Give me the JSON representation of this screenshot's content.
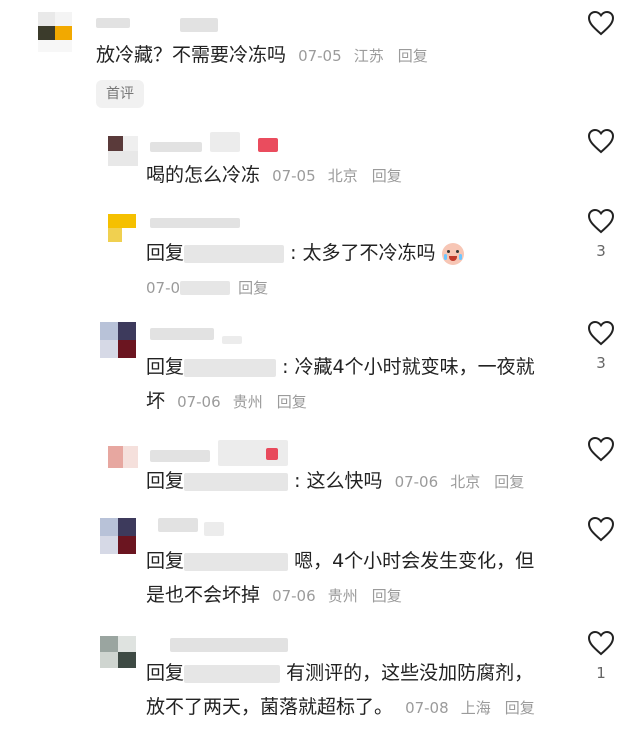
{
  "colors": {
    "heart": "#222222",
    "meta": "#9b9b9b"
  },
  "top_comment": {
    "text": "放冷藏？不需要冷冻吗",
    "date": "07-05",
    "location": "江苏",
    "reply": "回复",
    "tag": "首评"
  },
  "replies": [
    {
      "text": "喝的怎么冷冻",
      "date": "07-05",
      "location": "北京",
      "reply": "回复",
      "likes": ""
    },
    {
      "prefix": "回复",
      "text": ": 太多了不冷冻吗",
      "emoji": "crying-face",
      "date": "07-0",
      "reply": "回复",
      "likes": "3"
    },
    {
      "prefix": "回复",
      "text": ": 冷藏4个小时就变味，一夜就",
      "text2": "坏",
      "date": "07-06",
      "location": "贵州",
      "reply": "回复",
      "likes": "3"
    },
    {
      "prefix": "回复",
      "text": ": 这么快吗",
      "date": "07-06",
      "location": "北京",
      "reply": "回复",
      "likes": ""
    },
    {
      "prefix": "回复",
      "text": "嗯，4个小时会发生变化，但",
      "text2": "是也不会坏掉",
      "date": "07-06",
      "location": "贵州",
      "reply": "回复",
      "likes": ""
    },
    {
      "prefix": "回复",
      "text": "有测评的，这些没加防腐剂，",
      "text2": "放不了两天，菌落就超标了。",
      "date": "07-08",
      "location": "上海",
      "reply": "回复",
      "likes": "1"
    }
  ]
}
